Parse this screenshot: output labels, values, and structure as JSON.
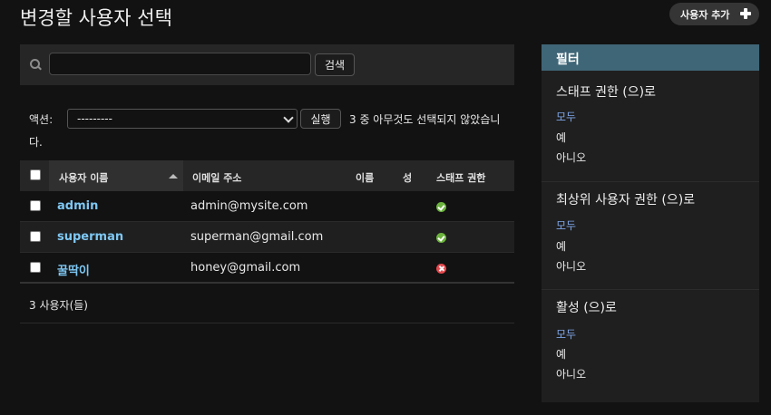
{
  "page": {
    "title": "변경할 사용자 선택",
    "add_button_label": "사용자 추가"
  },
  "search": {
    "value": "",
    "button_label": "검색"
  },
  "actions": {
    "label": "액션:",
    "selected_value": "---------",
    "run_label": "실행",
    "selection_text_line1": "3 중 아무것도 선택되지 않았습니",
    "selection_text_line2": "다."
  },
  "table": {
    "headers": [
      "사용자 이름",
      "이메일 주소",
      "이름",
      "성",
      "스태프 권한"
    ],
    "rows": [
      {
        "username": "admin",
        "email": "admin@mysite.com",
        "first_name": "",
        "last_name": "",
        "is_staff": true
      },
      {
        "username": "superman",
        "email": "superman@gmail.com",
        "first_name": "",
        "last_name": "",
        "is_staff": true
      },
      {
        "username": "꿀딱이",
        "email": "honey@gmail.com",
        "first_name": "",
        "last_name": "",
        "is_staff": false
      }
    ],
    "count_text": "3 사용자(들)"
  },
  "filter": {
    "title": "필터",
    "groups": [
      {
        "heading": "스태프 권한 (으)로",
        "options": [
          "모두",
          "예",
          "아니오"
        ],
        "selected": "모두"
      },
      {
        "heading": "최상위 사용자 권한 (으)로",
        "options": [
          "모두",
          "예",
          "아니오"
        ],
        "selected": "모두"
      },
      {
        "heading": "활성 (으)로",
        "options": [
          "모두",
          "예",
          "아니오"
        ],
        "selected": "모두"
      }
    ]
  },
  "colors": {
    "link": "#7ec8f4",
    "filter_header": "#3f6677",
    "status_yes": "#6cb33e",
    "status_no": "#e5484d",
    "filter_selected": "#7ea5e6"
  }
}
